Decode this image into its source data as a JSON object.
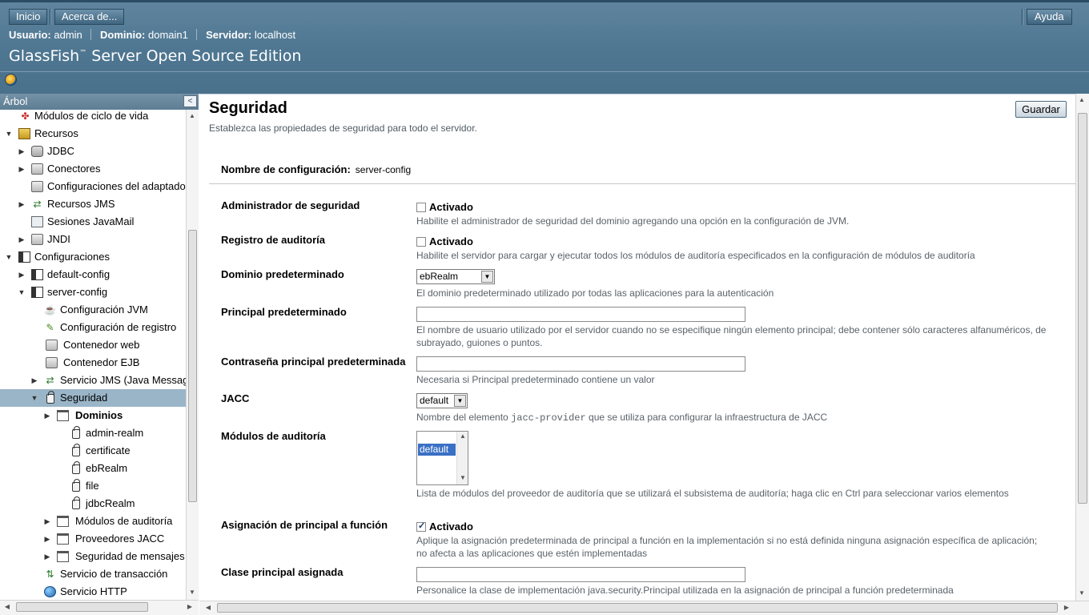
{
  "masthead": {
    "home_label": "Inicio",
    "about_label": "Acerca de...",
    "help_label": "Ayuda",
    "user_key": "Usuario:",
    "user_val": "admin",
    "domain_key": "Dominio:",
    "domain_val": "domain1",
    "server_key": "Servidor:",
    "server_val": "localhost",
    "product_name": "GlassFish",
    "product_tm": "™",
    "product_rest": " Server Open Source Edition"
  },
  "tree": {
    "title": "Árbol",
    "collapse": "<",
    "nodes": [
      {
        "label": "Módulos de ciclo de vida"
      },
      {
        "label": "Recursos"
      },
      {
        "label": "JDBC"
      },
      {
        "label": "Conectores"
      },
      {
        "label": "Configuraciones del adaptador"
      },
      {
        "label": "Recursos JMS"
      },
      {
        "label": "Sesiones JavaMail"
      },
      {
        "label": "JNDI"
      },
      {
        "label": "Configuraciones"
      },
      {
        "label": "default-config"
      },
      {
        "label": "server-config"
      },
      {
        "label": "Configuración JVM"
      },
      {
        "label": "Configuración de registro"
      },
      {
        "label": "Contenedor web"
      },
      {
        "label": "Contenedor EJB"
      },
      {
        "label": "Servicio JMS (Java Messag"
      },
      {
        "label": "Seguridad"
      },
      {
        "label": "Dominios"
      },
      {
        "label": "admin-realm"
      },
      {
        "label": "certificate"
      },
      {
        "label": "ebRealm"
      },
      {
        "label": "file"
      },
      {
        "label": "jdbcRealm"
      },
      {
        "label": "Módulos de auditoría"
      },
      {
        "label": "Proveedores JACC"
      },
      {
        "label": "Seguridad de mensajes"
      },
      {
        "label": "Servicio de transacción"
      },
      {
        "label": "Servicio HTTP"
      }
    ]
  },
  "content": {
    "title": "Seguridad",
    "help": "Establezca las propiedades de seguridad para todo el servidor.",
    "save_label": "Guardar",
    "config_name_label": "Nombre de configuración:",
    "config_name_value": "server-config",
    "fields": {
      "security_manager": {
        "label": "Administrador de seguridad",
        "checkbox_label": "Activado",
        "checked": false,
        "help": "Habilite el administrador de seguridad del dominio agregando una opción en la configuración de JVM."
      },
      "audit_logging": {
        "label": "Registro de auditoría",
        "checkbox_label": "Activado",
        "checked": false,
        "help": "Habilite el servidor para cargar y ejecutar todos los módulos de auditoría especificados en la configuración de módulos de auditoría"
      },
      "default_realm": {
        "label": "Dominio predeterminado",
        "value": "ebRealm",
        "help": "El dominio predeterminado utilizado por todas las aplicaciones para la autenticación"
      },
      "default_principal": {
        "label": "Principal predeterminado",
        "value": "",
        "help": "El nombre de usuario utilizado por el servidor cuando no se especifique ningún elemento principal; debe contener sólo caracteres alfanuméricos, de subrayado, guiones o puntos."
      },
      "default_principal_password": {
        "label": "Contraseña principal predeterminada",
        "value": "",
        "help": "Necesaria si Principal predeterminado contiene un valor"
      },
      "jacc": {
        "label": "JACC",
        "value": "default",
        "help_pre": "Nombre del elemento ",
        "help_code": "jacc-provider",
        "help_post": " que se utiliza para configurar la infraestructura de JACC"
      },
      "audit_modules": {
        "label": "Módulos de auditoría",
        "selected_option": "default",
        "help": "Lista de módulos del proveedor de auditoría que se utilizará el subsistema de auditoría; haga clic en Ctrl para seleccionar varios elementos"
      },
      "principal_role_mapping": {
        "label": "Asignación de principal a función",
        "checkbox_label": "Activado",
        "checked": true,
        "help": "Aplique la asignación predeterminada de principal a función en la implementación si no está definida ninguna asignación específica de aplicación; no afecta a las aplicaciones que estén implementadas"
      },
      "mapped_principal_class": {
        "label": "Clase principal asignada",
        "value": "",
        "help": "Personalice la clase de implementación java.security.Principal utilizada en la asignación de principal a función predeterminada"
      }
    }
  }
}
